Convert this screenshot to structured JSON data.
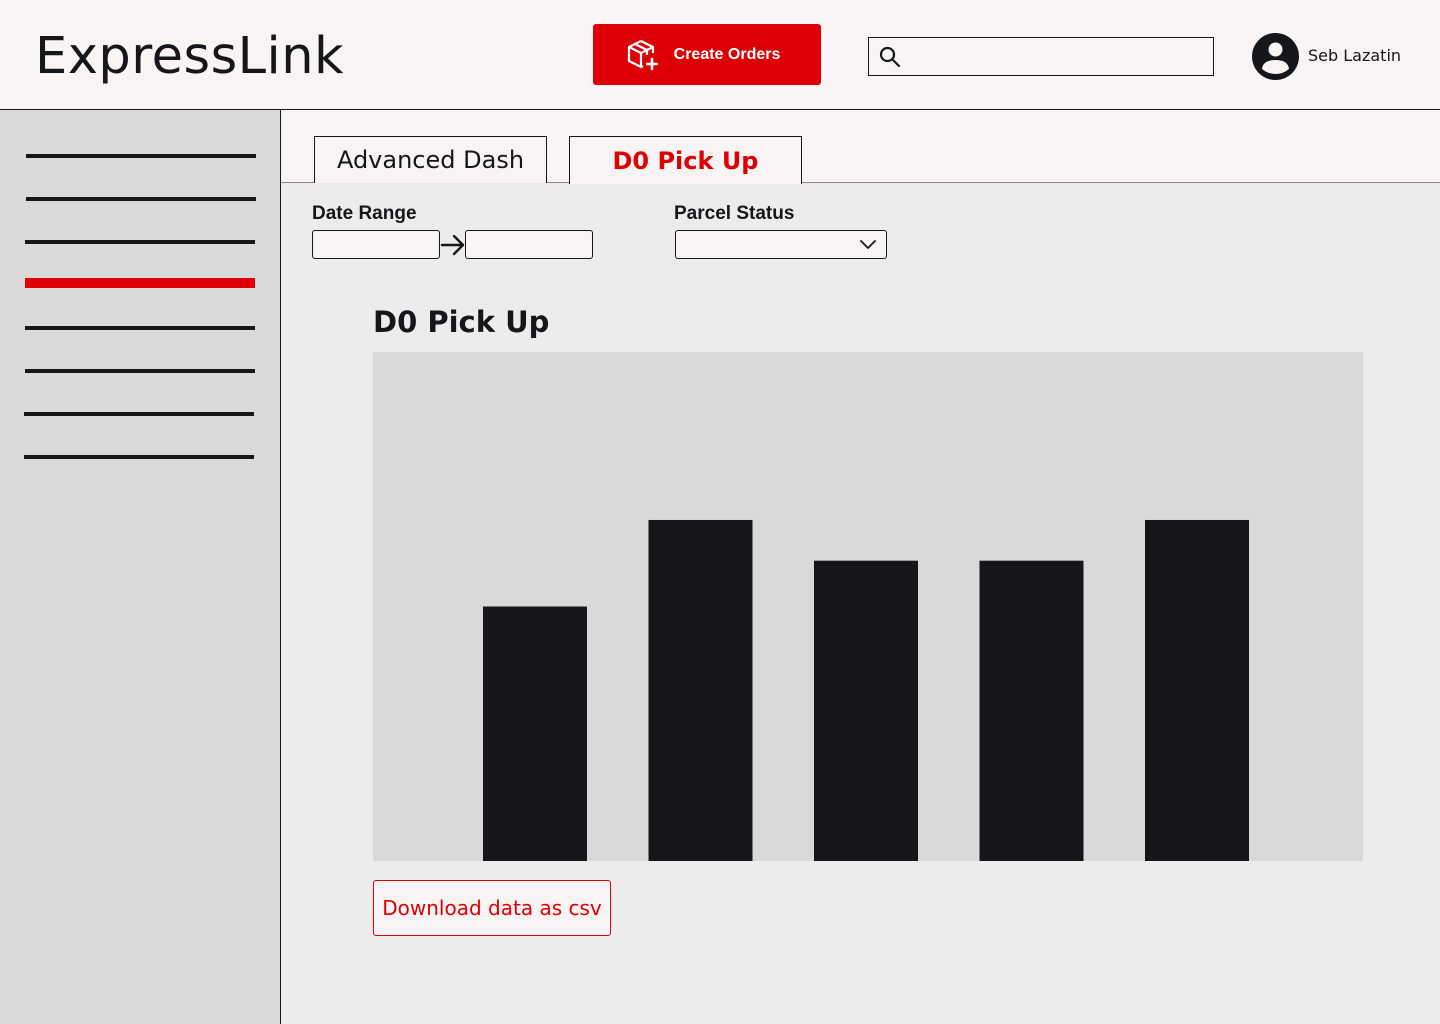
{
  "app": {
    "name": "ExpressLink"
  },
  "header": {
    "create_orders_label": "Create Orders",
    "search": {
      "value": "",
      "placeholder": ""
    },
    "user_name": "Seb Lazatin"
  },
  "sidebar": {
    "items": [
      {
        "id": "nav-1",
        "active": false
      },
      {
        "id": "nav-2",
        "active": false
      },
      {
        "id": "nav-3",
        "active": false
      },
      {
        "id": "nav-4",
        "active": true
      },
      {
        "id": "nav-5",
        "active": false
      },
      {
        "id": "nav-6",
        "active": false
      },
      {
        "id": "nav-7",
        "active": false
      },
      {
        "id": "nav-8",
        "active": false
      }
    ]
  },
  "tabs": [
    {
      "label": "Advanced Dash",
      "active": false
    },
    {
      "label": "D0 Pick Up",
      "active": true
    }
  ],
  "filters": {
    "date_range_label": "Date Range",
    "date_from": "",
    "date_to": "",
    "parcel_status_label": "Parcel Status",
    "parcel_status_value": ""
  },
  "chart_title": "D0 Pick Up",
  "chart_data": {
    "type": "bar",
    "title": "D0 Pick Up",
    "categories": [
      "",
      "",
      "",
      "",
      ""
    ],
    "values": [
      0.5,
      0.67,
      0.59,
      0.59,
      0.67
    ],
    "ylim": [
      0,
      1
    ],
    "xlabel": "",
    "ylabel": "",
    "grid": false,
    "bar_color": "#15161a",
    "background": "#d9d9d9"
  },
  "download_label": "Download data as csv",
  "colors": {
    "accent": "#dd0004",
    "ink": "#15161a",
    "panel": "#f7f4f3",
    "sidebar": "#d9d9d9",
    "content": "#ececec"
  },
  "icons": {
    "create_orders": "package-plus-icon",
    "search": "search-icon",
    "avatar": "user-avatar-icon",
    "date_arrow": "arrow-right-icon",
    "dropdown": "chevron-down-icon"
  }
}
